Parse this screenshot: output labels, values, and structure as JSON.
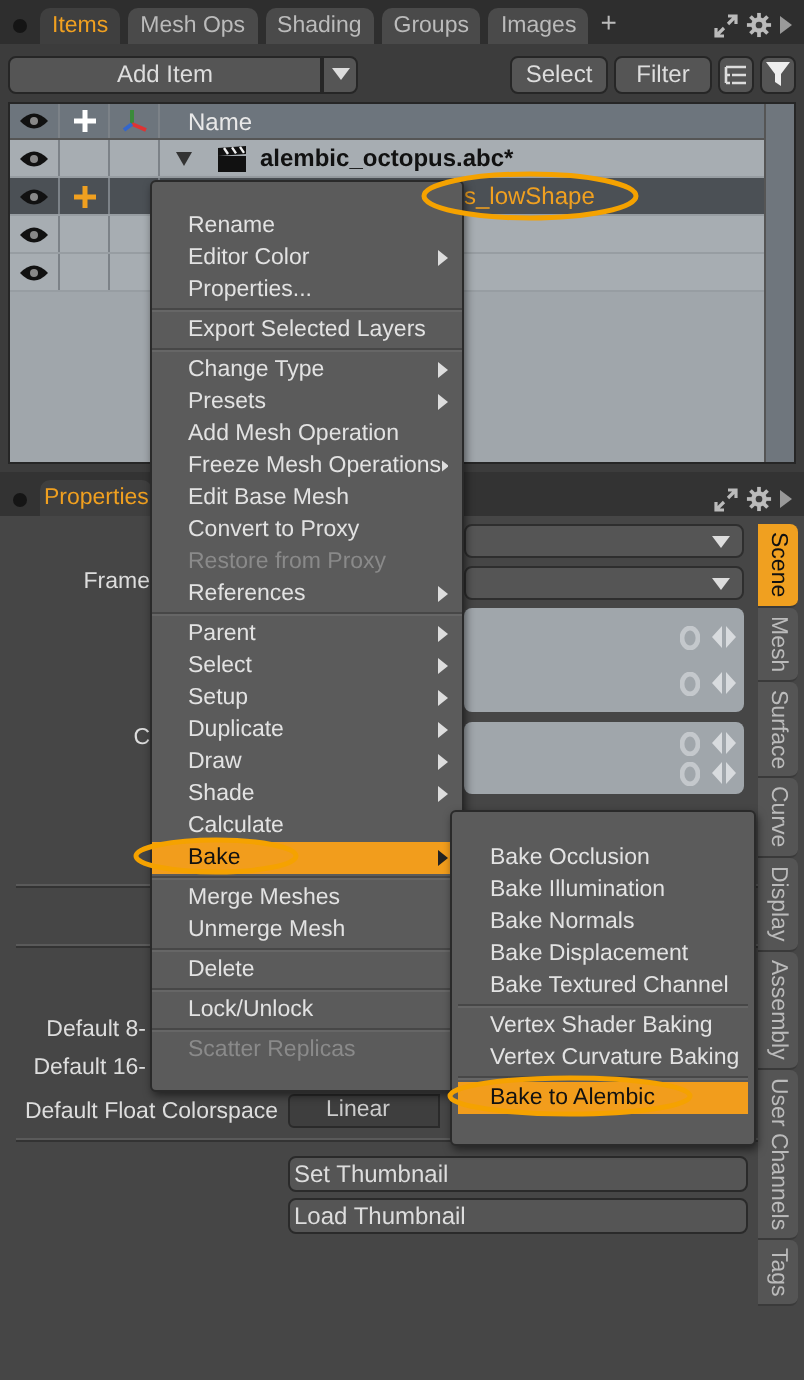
{
  "top_tabs": [
    {
      "label": "Items",
      "selected": true
    },
    {
      "label": "Mesh Ops",
      "selected": false
    },
    {
      "label": "Shading",
      "selected": false
    },
    {
      "label": "Groups",
      "selected": false
    },
    {
      "label": "Images",
      "selected": false
    }
  ],
  "add_tab": "+",
  "toolbar": {
    "add_item": "Add Item",
    "select": "Select",
    "filter": "Filter"
  },
  "item_list": {
    "name_column": "Name",
    "rows": [
      {
        "kind": "scene",
        "name": "alembic_octopus.abc*",
        "selected": false
      },
      {
        "kind": "mesh",
        "name": "s_lowShape",
        "selected": true
      },
      {
        "kind": "blank",
        "selected": false
      },
      {
        "kind": "blank",
        "selected": false
      }
    ]
  },
  "properties": {
    "tab": "Properties",
    "upper_rows": [
      {
        "kind": "dropdown"
      },
      {
        "kind": "dropdown",
        "label": "Frame"
      },
      {
        "kind": "channels"
      },
      {
        "kind": "channels",
        "label": "C"
      }
    ],
    "lower_rows": [
      {
        "kind": "label",
        "label": "Default 8-"
      },
      {
        "kind": "label",
        "label": "Default 16-"
      },
      {
        "kind": "dropdown",
        "label": "Default Float Colorspace",
        "value": "Linear"
      }
    ],
    "buttons": [
      "Set Thumbnail",
      "Load Thumbnail"
    ]
  },
  "side_tabs": [
    {
      "label": "Scene",
      "selected": true
    },
    {
      "label": "Mesh",
      "selected": false
    },
    {
      "label": "Surface",
      "selected": false
    },
    {
      "label": "Curve",
      "selected": false
    },
    {
      "label": "Display",
      "selected": false
    },
    {
      "label": "Assembly",
      "selected": false
    },
    {
      "label": "User Channels",
      "selected": false
    },
    {
      "label": "Tags",
      "selected": false
    }
  ],
  "context_menu": {
    "items": [
      {
        "kind": "item",
        "label": "Rename",
        "submenu": false,
        "disabled": false,
        "selected": false
      },
      {
        "kind": "item",
        "label": "Editor Color",
        "submenu": true,
        "disabled": false,
        "selected": false
      },
      {
        "kind": "item",
        "label": "Properties...",
        "submenu": false,
        "disabled": false,
        "selected": false
      },
      {
        "kind": "separator"
      },
      {
        "kind": "item",
        "label": "Export Selected Layers",
        "submenu": false,
        "disabled": false,
        "selected": false
      },
      {
        "kind": "separator"
      },
      {
        "kind": "item",
        "label": "Change Type",
        "submenu": true,
        "disabled": false,
        "selected": false
      },
      {
        "kind": "item",
        "label": "Presets",
        "submenu": true,
        "disabled": false,
        "selected": false
      },
      {
        "kind": "item",
        "label": "Add Mesh Operation",
        "submenu": false,
        "disabled": false,
        "selected": false
      },
      {
        "kind": "item",
        "label": "Freeze Mesh Operations",
        "submenu": true,
        "disabled": false,
        "selected": false
      },
      {
        "kind": "item",
        "label": "Edit Base Mesh",
        "submenu": false,
        "disabled": false,
        "selected": false
      },
      {
        "kind": "item",
        "label": "Convert to Proxy",
        "submenu": false,
        "disabled": false,
        "selected": false
      },
      {
        "kind": "item",
        "label": "Restore from Proxy",
        "submenu": false,
        "disabled": true,
        "selected": false
      },
      {
        "kind": "item",
        "label": "References",
        "submenu": true,
        "disabled": false,
        "selected": false
      },
      {
        "kind": "separator"
      },
      {
        "kind": "item",
        "label": "Parent",
        "submenu": true,
        "disabled": false,
        "selected": false
      },
      {
        "kind": "item",
        "label": "Select",
        "submenu": true,
        "disabled": false,
        "selected": false
      },
      {
        "kind": "item",
        "label": "Setup",
        "submenu": true,
        "disabled": false,
        "selected": false
      },
      {
        "kind": "item",
        "label": "Duplicate",
        "submenu": true,
        "disabled": false,
        "selected": false
      },
      {
        "kind": "item",
        "label": "Draw",
        "submenu": true,
        "disabled": false,
        "selected": false
      },
      {
        "kind": "item",
        "label": "Shade",
        "submenu": true,
        "disabled": false,
        "selected": false
      },
      {
        "kind": "item",
        "label": "Calculate",
        "submenu": false,
        "disabled": false,
        "selected": false
      },
      {
        "kind": "item",
        "label": "Bake",
        "submenu": true,
        "disabled": false,
        "selected": true
      },
      {
        "kind": "separator"
      },
      {
        "kind": "item",
        "label": "Merge Meshes",
        "submenu": false,
        "disabled": false,
        "selected": false
      },
      {
        "kind": "item",
        "label": "Unmerge Mesh",
        "submenu": false,
        "disabled": false,
        "selected": false
      },
      {
        "kind": "separator"
      },
      {
        "kind": "item",
        "label": "Delete",
        "submenu": false,
        "disabled": false,
        "selected": false
      },
      {
        "kind": "separator"
      },
      {
        "kind": "item",
        "label": "Lock/Unlock",
        "submenu": false,
        "disabled": false,
        "selected": false
      },
      {
        "kind": "separator"
      },
      {
        "kind": "item",
        "label": "Scatter Replicas",
        "submenu": false,
        "disabled": true,
        "selected": false
      }
    ]
  },
  "bake_submenu": {
    "items": [
      {
        "kind": "item",
        "label": "Bake Occlusion",
        "selected": false
      },
      {
        "kind": "item",
        "label": "Bake Illumination",
        "selected": false
      },
      {
        "kind": "item",
        "label": "Bake Normals",
        "selected": false
      },
      {
        "kind": "item",
        "label": "Bake Displacement",
        "selected": false
      },
      {
        "kind": "item",
        "label": "Bake Textured Channel",
        "selected": false
      },
      {
        "kind": "separator"
      },
      {
        "kind": "item",
        "label": "Vertex Shader Baking",
        "selected": false
      },
      {
        "kind": "item",
        "label": "Vertex Curvature Baking",
        "selected": false
      },
      {
        "kind": "separator"
      },
      {
        "kind": "item",
        "label": "Bake to Alembic",
        "selected": true
      }
    ]
  }
}
